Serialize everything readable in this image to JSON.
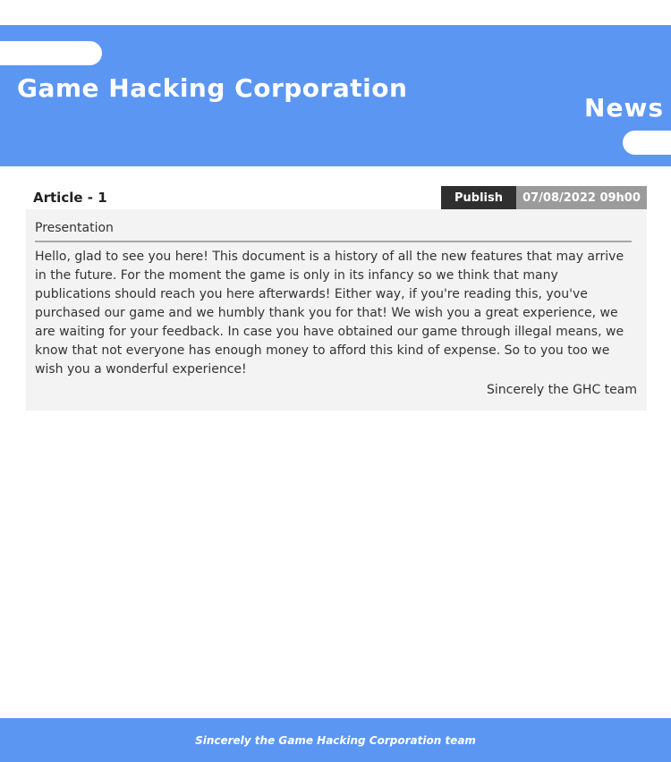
{
  "header": {
    "site_title": "Game Hacking Corporation",
    "section_title": "News"
  },
  "article": {
    "title": "Article - 1",
    "publish_label": "Publish",
    "publish_date": "07/08/2022 09h00",
    "section": "Presentation",
    "body": "Hello, glad to see you here! This document is a history of all the new features that may arrive in the future. For the moment the game is only in its infancy so we think that many publications should reach you here afterwards! Either way, if you're reading this, you've purchased our game and we humbly thank you for that! We wish you a great experience, we are waiting for your feedback. In case you have obtained our game through illegal means, we know that not everyone has enough money to afford this kind of expense. So to you too we wish you a wonderful experience!",
    "signature": "Sincerely the GHC team"
  },
  "footer": {
    "text": "Sincerely the Game Hacking Corporation team"
  },
  "colors": {
    "brand_blue": "#5c96f3",
    "publish_dark": "#2f2f2f",
    "date_gray": "#9b9b9b",
    "body_bg": "#f3f3f3"
  }
}
